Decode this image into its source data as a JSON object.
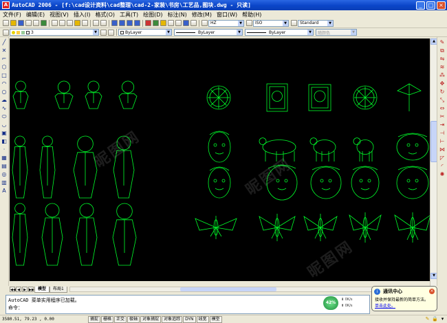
{
  "window": {
    "title": "AutoCAD 2006 - [f:\\cad设计资料\\cad整理\\cad-2-家装\\书房\\工艺品,图块.dwg - 只读]",
    "app_icon": "autocad-logo-icon",
    "controls": [
      "minimize-icon",
      "maximize-icon",
      "close-icon"
    ]
  },
  "menu": [
    "文件(F)",
    "编辑(E)",
    "视图(V)",
    "插入(I)",
    "格式(O)",
    "工具(T)",
    "绘图(D)",
    "标注(N)",
    "修改(M)",
    "窗口(W)",
    "帮助(H)"
  ],
  "toolbar": {
    "layer_value": "3",
    "color_value": "ByLayer",
    "linetype_value": "ByLayer",
    "lineweight_value": "ByLayer",
    "plotstyle_value": "随颜色",
    "dim_style_value": "ISO",
    "text_style_value": "Standard",
    "style_value": "HZ"
  },
  "left_tools": [
    "line-icon",
    "construction-line-icon",
    "polyline-icon",
    "polygon-icon",
    "rectangle-icon",
    "arc-icon",
    "circle-icon",
    "revision-cloud-icon",
    "spline-icon",
    "ellipse-icon",
    "ellipse-arc-icon",
    "insert-block-icon",
    "make-block-icon",
    "point-icon",
    "hatch-icon",
    "gradient-icon",
    "region-icon",
    "table-icon",
    "multiline-text-icon"
  ],
  "right_tools": [
    "erase-icon",
    "copy-icon",
    "mirror-icon",
    "offset-icon",
    "array-icon",
    "move-icon",
    "rotate-icon",
    "scale-icon",
    "stretch-icon",
    "trim-icon",
    "extend-icon",
    "break-at-point-icon",
    "break-icon",
    "join-icon",
    "chamfer-icon",
    "fillet-icon",
    "explode-icon"
  ],
  "drawing": {
    "background": "#000000",
    "line_color": "#00ff2a",
    "blocks": [
      "bust-1",
      "bust-2",
      "bust-3",
      "bust-4",
      "clock",
      "carriage-clock",
      "wall-clock",
      "ship-wheel",
      "flags",
      "statue-1",
      "statue-2",
      "statue-3",
      "statue-4",
      "indian-head",
      "rhinoceros",
      "horse",
      "figure",
      "ox-skull",
      "dancer-1",
      "dancer-2",
      "dancer-3",
      "dancer-4",
      "mask-1",
      "mask-2",
      "mask-3",
      "mask-4",
      "mask-5",
      "butterfly-1",
      "kite-2",
      "kite-3",
      "kite-4",
      "butterfly-5"
    ]
  },
  "tabs": [
    "模型",
    "布局1"
  ],
  "command": {
    "line1": "AutoCAD 菜单实用程序已加载。",
    "line2": "命令："
  },
  "progress": {
    "percent": "42%",
    "down": "0K/s",
    "up": "0K/s"
  },
  "notification": {
    "title": "通讯中心",
    "body": "接收并保持最新的简单方法。",
    "link": "单击此处。"
  },
  "status": {
    "coords": "3580.51, 79.23 , 0.00",
    "toggles": [
      "捕捉",
      "栅格",
      "正交",
      "极轴",
      "对象捕捉",
      "对象追踪",
      "DYN",
      "线宽",
      "模型"
    ]
  }
}
